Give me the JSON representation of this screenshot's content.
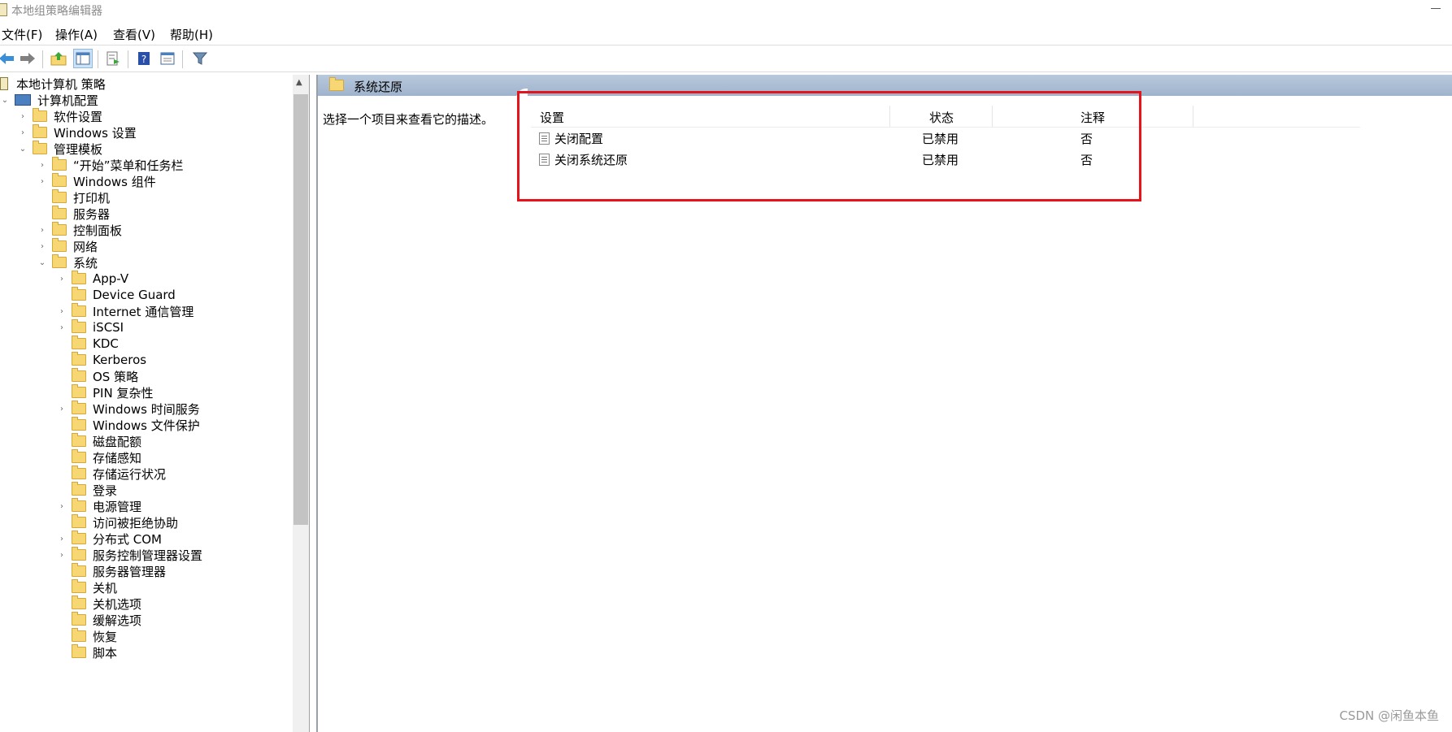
{
  "window": {
    "title": "本地组策略编辑器"
  },
  "menu": [
    "文件(F)",
    "操作(A)",
    "查看(V)",
    "帮助(H)"
  ],
  "tree": {
    "root": "本地计算机 策略",
    "computer_config": "计算机配置",
    "software_settings": "软件设置",
    "windows_settings": "Windows 设置",
    "admin_templates": "管理模板",
    "admin_children": [
      "“开始”菜单和任务栏",
      "Windows 组件",
      "打印机",
      "服务器",
      "控制面板",
      "网络",
      "系统"
    ],
    "system_children": [
      "App-V",
      "Device Guard",
      "Internet 通信管理",
      "iSCSI",
      "KDC",
      "Kerberos",
      "OS 策略",
      "PIN 复杂性",
      "Windows 时间服务",
      "Windows 文件保护",
      "磁盘配额",
      "存储感知",
      "存储运行状况",
      "登录",
      "电源管理",
      "访问被拒绝协助",
      "分布式 COM",
      "服务控制管理器设置",
      "服务器管理器",
      "关机",
      "关机选项",
      "缓解选项",
      "恢复",
      "脚本"
    ]
  },
  "right_pane": {
    "title": "系统还原",
    "description": "选择一个项目来查看它的描述。",
    "columns": {
      "setting": "设置",
      "state": "状态",
      "comment": "注释"
    },
    "rows": [
      {
        "setting": "关闭配置",
        "state": "已禁用",
        "comment": "否"
      },
      {
        "setting": "关闭系统还原",
        "state": "已禁用",
        "comment": "否"
      }
    ]
  },
  "watermark": "CSDN @闲鱼本鱼",
  "colors": {
    "highlight_border": "#e3141b",
    "pane_header": "#a9bcd3",
    "folder": "#f7d774"
  }
}
